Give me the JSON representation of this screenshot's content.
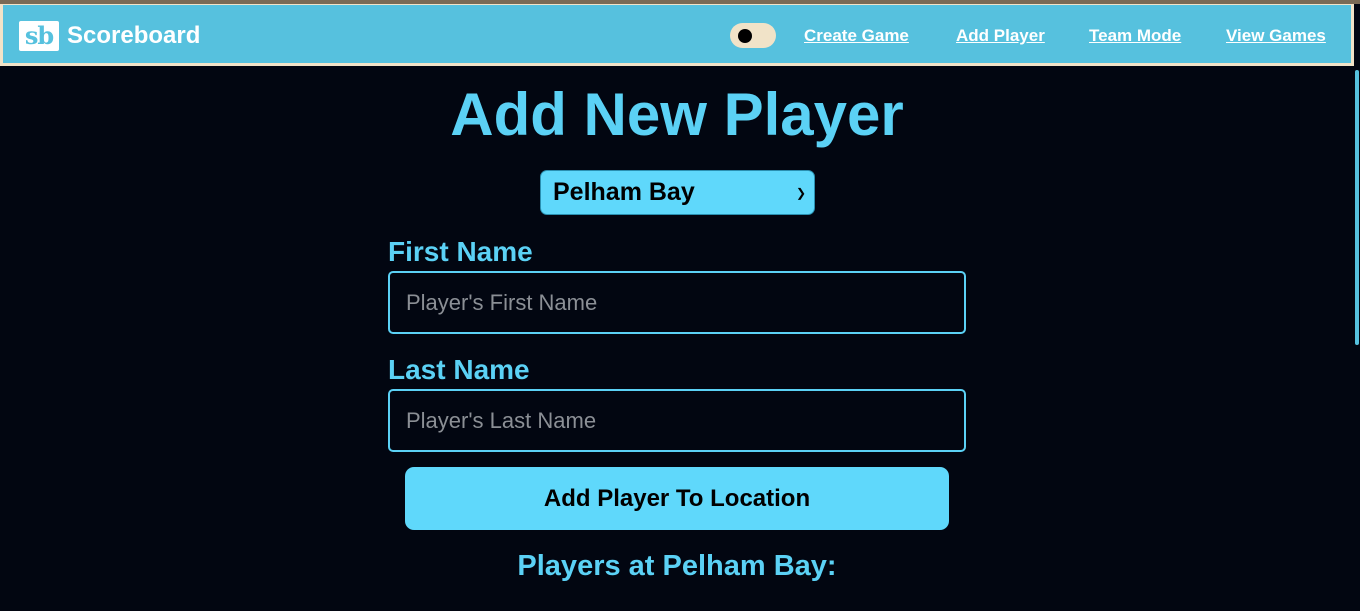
{
  "navbar": {
    "logo_text": "sb",
    "brand_name": "Scoreboard",
    "theme_toggle": "dark-mode-toggle",
    "links": [
      "Create Game",
      "Add Player",
      "Team Mode",
      "View Games"
    ]
  },
  "page": {
    "title": "Add New Player",
    "location_select": {
      "selected": "Pelham Bay"
    },
    "first_name": {
      "label": "First Name",
      "value": "",
      "placeholder": "Player's First Name"
    },
    "last_name": {
      "label": "Last Name",
      "value": "",
      "placeholder": "Player's Last Name"
    },
    "submit_label": "Add Player To Location",
    "players_heading": "Players at Pelham Bay:"
  },
  "colors": {
    "navbar_bg": "#56c1de",
    "accent": "#5bd1f5",
    "button_bg": "#5fd8fb",
    "page_bg": "#020611",
    "toggle_bg": "#f1e3c8"
  }
}
